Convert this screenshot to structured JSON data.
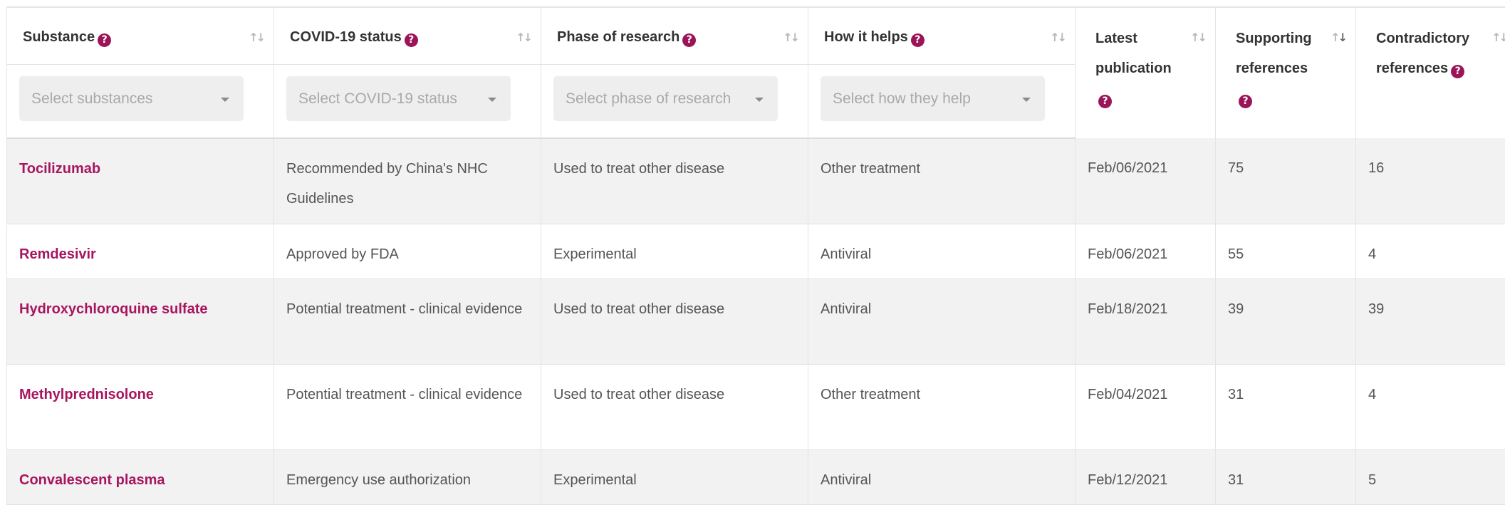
{
  "table": {
    "columns": [
      {
        "label": "Substance",
        "filter_placeholder": "Select substances"
      },
      {
        "label": "COVID-19 status",
        "filter_placeholder": "Select COVID-19 status"
      },
      {
        "label": "Phase of research",
        "filter_placeholder": "Select phase of research"
      },
      {
        "label": "How it helps",
        "filter_placeholder": "Select how they help"
      },
      {
        "label": "Latest publication"
      },
      {
        "label": "Supporting references"
      },
      {
        "label": "Contradictory references"
      }
    ],
    "sort_icon": "sort-arrows-icon",
    "help_icon": "help-circle-icon",
    "dropdown_icon": "caret-down-icon",
    "accent_color": "#9b1457",
    "rows": [
      {
        "substance": "Tocilizumab",
        "status": "Recommended by China's NHC Guidelines",
        "phase": "Used to treat other disease",
        "helps": "Other treatment",
        "latest": "Feb/06/2021",
        "supporting": "75",
        "contradictory": "16"
      },
      {
        "substance": "Remdesivir",
        "status": "Approved by FDA",
        "phase": "Experimental",
        "helps": "Antiviral",
        "latest": "Feb/06/2021",
        "supporting": "55",
        "contradictory": "4"
      },
      {
        "substance": "Hydroxychloroquine sulfate",
        "status": "Potential treatment - clinical evidence",
        "phase": "Used to treat other disease",
        "helps": "Antiviral",
        "latest": "Feb/18/2021",
        "supporting": "39",
        "contradictory": "39"
      },
      {
        "substance": "Methylprednisolone",
        "status": "Potential treatment - clinical evidence",
        "phase": "Used to treat other disease",
        "helps": "Other treatment",
        "latest": "Feb/04/2021",
        "supporting": "31",
        "contradictory": "4"
      },
      {
        "substance": "Convalescent plasma",
        "status": "Emergency use authorization",
        "phase": "Experimental",
        "helps": "Antiviral",
        "latest": "Feb/12/2021",
        "supporting": "31",
        "contradictory": "5"
      }
    ]
  }
}
